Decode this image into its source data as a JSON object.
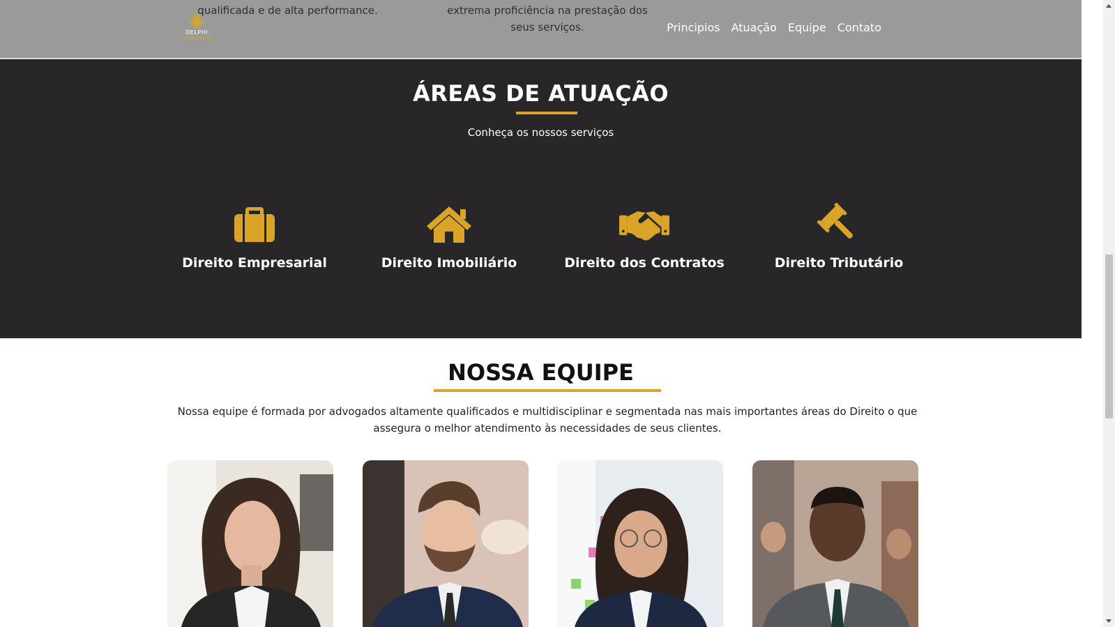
{
  "header": {
    "logo_text": "DELPHI",
    "logo_subtext": "ADVOGADOS",
    "nav": [
      "Principios",
      "Atuação",
      "Equipe",
      "Contato"
    ]
  },
  "top_section": {
    "paragraph_left": "qualificada e de alta performance.",
    "paragraph_right": "extrema proficiência na prestação dos seus serviços."
  },
  "areas": {
    "title": "ÁREAS DE ATUAÇÃO",
    "subtitle": "Conheça os nossos serviços",
    "services": [
      {
        "label": "Direito Empresarial",
        "icon": "briefcase-icon"
      },
      {
        "label": "Direito Imobiliário",
        "icon": "house-icon"
      },
      {
        "label": "Direito dos Contratos",
        "icon": "handshake-icon"
      },
      {
        "label": "Direito Tributário",
        "icon": "gavel-icon"
      }
    ]
  },
  "team": {
    "title": "NOSSA EQUIPE",
    "description": "Nossa equipe é formada por advogados altamente qualificados e multidisciplinar e segmentada nas mais importantes áreas do Direito o que assegura o melhor atendimento às necessidades de seus clientes."
  },
  "colors": {
    "accent": "#d9a427",
    "dark_section": "#29262a",
    "header_bg": "#9a9a9a"
  }
}
